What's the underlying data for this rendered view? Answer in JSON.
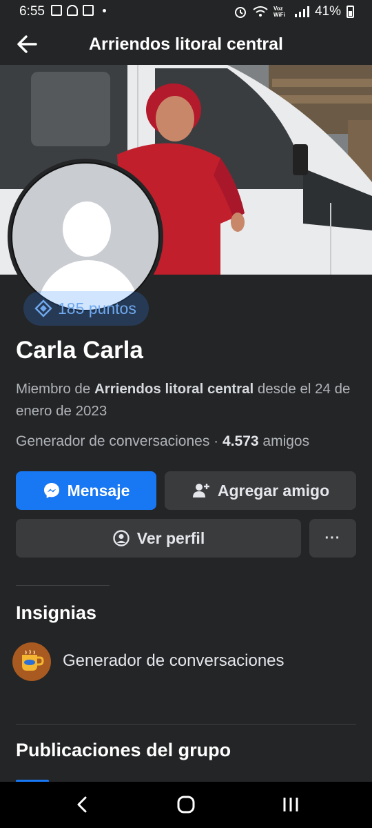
{
  "status_bar": {
    "time": "6:55",
    "carrier_tag": "Voz WiFi",
    "battery": "41%"
  },
  "header": {
    "title": "Arriendos litoral central",
    "back_icon": "arrow-left-icon"
  },
  "profile": {
    "points": "185 puntos",
    "name": "Carla Carla",
    "member_prefix": "Miembro de ",
    "group_name": "Arriendos litoral central",
    "member_suffix": " desde el 24 de enero de 2023",
    "badge_role": "Generador de conversaciones",
    "separator": " · ",
    "friends_count": "4.573",
    "friends_label": " amigos"
  },
  "actions": {
    "message_label": "Mensaje",
    "add_friend_label": "Agregar amigo",
    "view_profile_label": "Ver perfil",
    "more_label": "···"
  },
  "badges": {
    "title": "Insignias",
    "items": [
      {
        "label": "Generador de conversaciones",
        "icon": "coffee-cup-icon"
      }
    ]
  },
  "posts": {
    "title": "Publicaciones del grupo"
  },
  "colors": {
    "background": "#242526",
    "primary_button": "#1877f2",
    "secondary_button": "#3a3b3c",
    "points_text": "#6fa8ee"
  }
}
